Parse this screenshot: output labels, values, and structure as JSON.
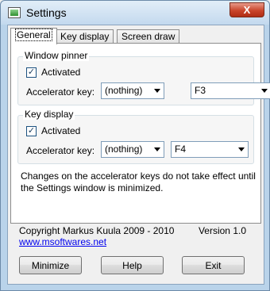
{
  "window": {
    "title": "Settings",
    "close_label": "X"
  },
  "tabs": [
    {
      "label": "General"
    },
    {
      "label": "Key display"
    },
    {
      "label": "Screen draw"
    }
  ],
  "window_pinner": {
    "title": "Window pinner",
    "activated_label": "Activated",
    "activated_checked": true,
    "accel_label": "Accelerator key:",
    "modifier_value": "(nothing)",
    "key_value": "F3"
  },
  "key_display": {
    "title": "Key display",
    "activated_label": "Activated",
    "activated_checked": true,
    "accel_label": "Accelerator key:",
    "modifier_value": "(nothing)",
    "key_value": "F4"
  },
  "note": "Changes on the accelerator keys do not take effect until the Settings window is minimized.",
  "footer": {
    "copyright": "Copyright Markus Kuula 2009 - 2010",
    "version": "Version 1.0",
    "link": "www.msoftwares.net"
  },
  "buttons": {
    "minimize": "Minimize",
    "help": "Help",
    "exit": "Exit"
  },
  "check_glyph": "✓"
}
